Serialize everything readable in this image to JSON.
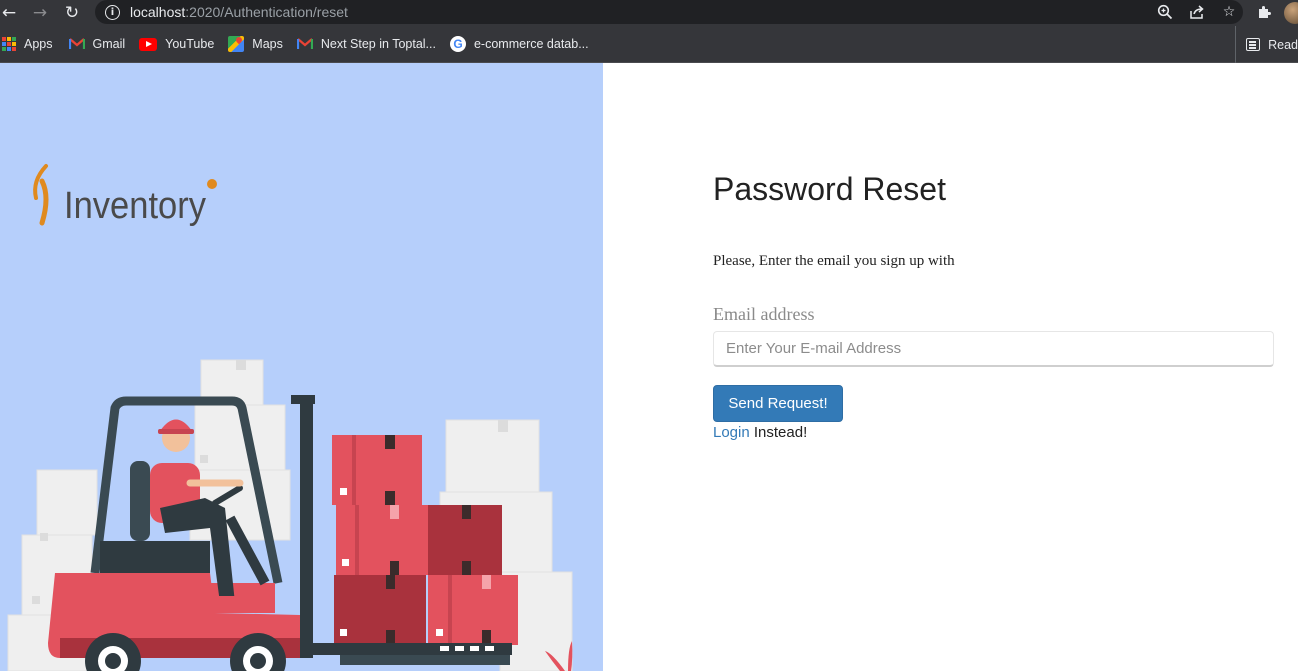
{
  "browser": {
    "url_host": "localhost",
    "url_path": ":2020/Authentication/reset",
    "icons": [
      "back-arrow-icon",
      "forward-arrow-icon",
      "reload-icon",
      "info-icon",
      "zoom-icon",
      "share-icon",
      "star-icon",
      "extensions-icon",
      "profile-avatar"
    ]
  },
  "bookmarks": [
    {
      "label": "Apps",
      "icon": "apps-grid-icon"
    },
    {
      "label": "Gmail",
      "icon": "gmail-icon"
    },
    {
      "label": "YouTube",
      "icon": "youtube-icon"
    },
    {
      "label": "Maps",
      "icon": "maps-icon"
    },
    {
      "label": "Next Step in Toptal...",
      "icon": "gmail-icon"
    },
    {
      "label": "e-commerce datab...",
      "icon": "google-icon"
    }
  ],
  "reading_list_label": "Read",
  "logo": {
    "text": "Inventory",
    "color": "#e08a1e"
  },
  "form": {
    "title": "Password Reset",
    "subtitle": "Please, Enter the email you sign up with",
    "email_label": "Email address",
    "email_placeholder": "Enter Your E-mail Address",
    "email_value": "",
    "submit_label": "Send Request!",
    "login_link": "Login",
    "login_suffix": " Instead!"
  },
  "colors": {
    "left_panel_bg": "#b6cffb",
    "button_bg": "#337ab7",
    "link": "#337ab7",
    "box_red": "#e3525e",
    "box_dark_red": "#a9323d"
  }
}
